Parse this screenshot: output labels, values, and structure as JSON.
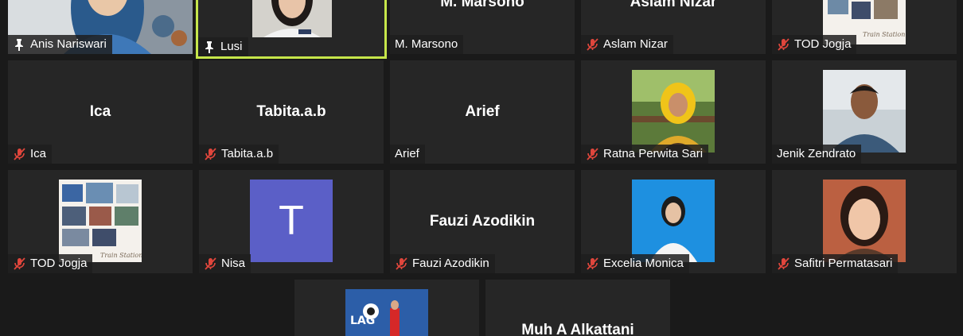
{
  "colors": {
    "background": "#1a1a1a",
    "tile": "#262626",
    "active_speaker_border": "#c6e64a",
    "mute_icon": "#e0463c",
    "avatar_bg": "#5b5fc7"
  },
  "participants": [
    {
      "name": "Anis Nariswari",
      "display": "",
      "icon": "pin-icon",
      "video": "on"
    },
    {
      "name": "Lusi",
      "display": "",
      "icon": "pin-icon",
      "video": "on",
      "active": true
    },
    {
      "name": "M. Marsono",
      "display": "M. Marsono",
      "icon": "",
      "video": "off"
    },
    {
      "name": "Aslam Nizar",
      "display": "Aslam Nizar",
      "icon": "muted-mic-icon",
      "video": "off"
    },
    {
      "name": "TOD Jogja",
      "display": "",
      "icon": "muted-mic-icon",
      "video": "picture"
    },
    {
      "name": "Ica",
      "display": "Ica",
      "icon": "muted-mic-icon",
      "video": "off"
    },
    {
      "name": "Tabita.a.b",
      "display": "Tabita.a.b",
      "icon": "muted-mic-icon",
      "video": "off"
    },
    {
      "name": "Arief",
      "display": "Arief",
      "icon": "",
      "video": "off"
    },
    {
      "name": "Ratna Perwita Sari",
      "display": "",
      "icon": "muted-mic-icon",
      "video": "picture"
    },
    {
      "name": "Jenik Zendrato",
      "display": "",
      "icon": "",
      "video": "picture"
    },
    {
      "name": "TOD Jogja",
      "display": "",
      "icon": "muted-mic-icon",
      "video": "picture"
    },
    {
      "name": "Nisa",
      "display": "T",
      "icon": "muted-mic-icon",
      "video": "avatar"
    },
    {
      "name": "Fauzi Azodikin",
      "display": "Fauzi Azodikin",
      "icon": "muted-mic-icon",
      "video": "off"
    },
    {
      "name": "Excelia Monica",
      "display": "",
      "icon": "muted-mic-icon",
      "video": "picture"
    },
    {
      "name": "Safitri Permatasari",
      "display": "",
      "icon": "muted-mic-icon",
      "video": "picture"
    },
    {
      "name": "",
      "display": "",
      "icon": "",
      "video": "picture"
    },
    {
      "name": "",
      "display": "Muh A Alkattani",
      "icon": "",
      "video": "off"
    }
  ]
}
